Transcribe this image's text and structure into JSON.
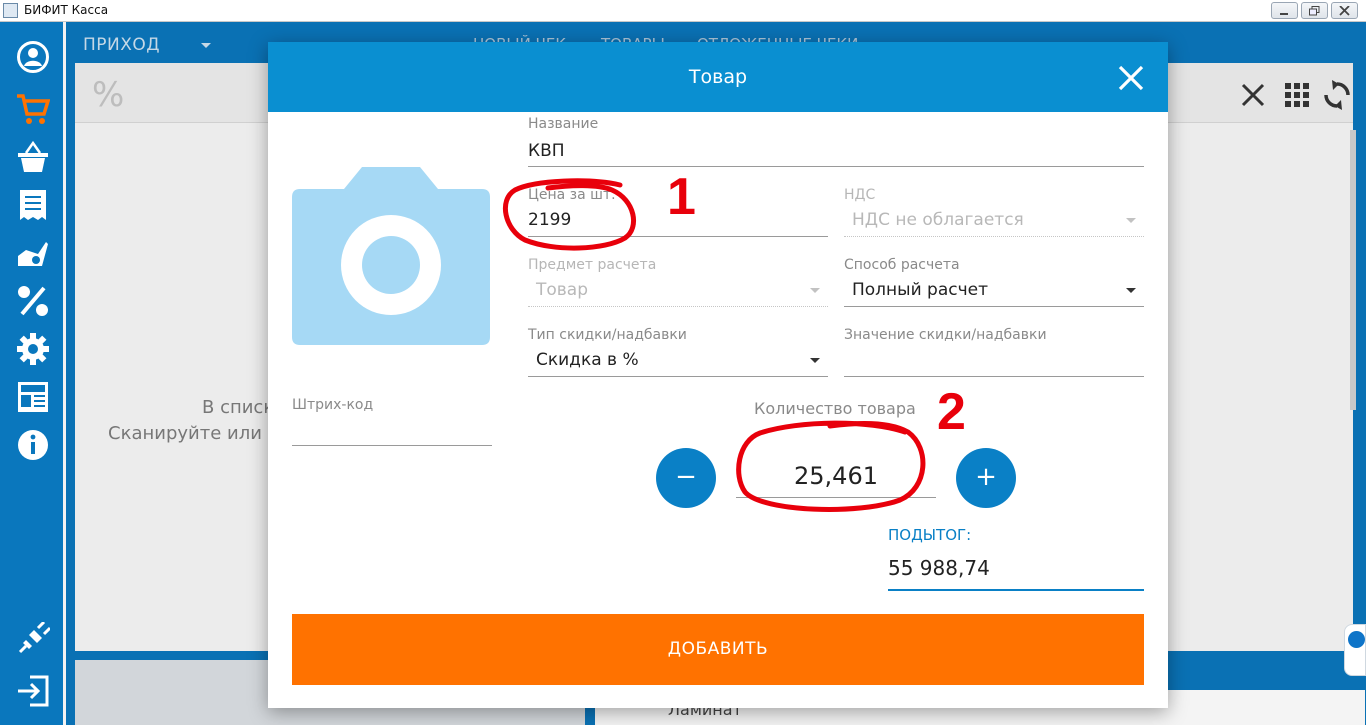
{
  "window": {
    "title": "БИФИТ Касса"
  },
  "background": {
    "mode_label": "ПРИХОД",
    "tabs": [
      "НОВЫЙ ЧЕК",
      "ТОВАРЫ",
      "ОТЛОЖЕННЫЕ ЧЕКИ"
    ],
    "percent_glyph": "%",
    "empty_line1": "В списк",
    "empty_line2": "Сканируйте или д",
    "list_item": "Ламинат"
  },
  "sidebar": {
    "items": [
      "user-icon",
      "cart-icon",
      "basket-icon",
      "receipt-icon",
      "hand-gear-icon",
      "percent-icon",
      "settings-icon",
      "news-icon",
      "info-icon",
      "plug-icon",
      "exit-icon"
    ],
    "accent": "#ff7200"
  },
  "modal": {
    "title": "Товар",
    "name": {
      "label": "Название",
      "value": "КВП"
    },
    "price": {
      "label": "Цена за шт.",
      "value": "2199"
    },
    "vat": {
      "label": "НДС",
      "value": "НДС не облагается"
    },
    "subject": {
      "label": "Предмет расчета",
      "value": "Товар"
    },
    "payment_method": {
      "label": "Способ расчета",
      "value": "Полный расчет"
    },
    "discount_type": {
      "label": "Тип скидки/надбавки",
      "value": "Скидка в %"
    },
    "discount_value": {
      "label": "Значение скидки/надбавки",
      "value": ""
    },
    "barcode": {
      "label": "Штрих-код",
      "value": ""
    },
    "quantity": {
      "label": "Количество товара",
      "value": "25,461",
      "minus": "−",
      "plus": "+"
    },
    "subtotal": {
      "label": "ПОДЫТОГ:",
      "value": "55 988,74"
    },
    "add_button": "ДОБАВИТЬ"
  },
  "annotations": {
    "marker1": "1",
    "marker2": "2",
    "color": "#e8000b"
  },
  "colors": {
    "header": "#0a8fd1",
    "button": "#ff7200",
    "accent": "#0a80c6"
  }
}
